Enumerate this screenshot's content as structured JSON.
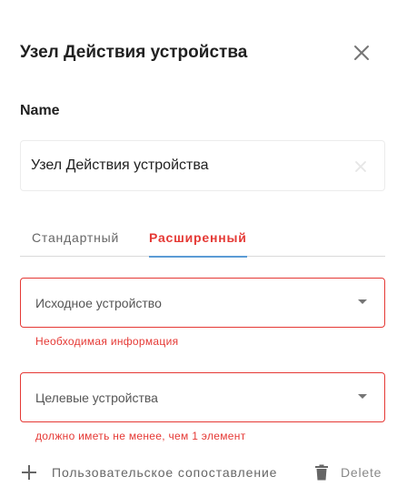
{
  "header": {
    "title": "Узел Действия устройства"
  },
  "name_section": {
    "label": "Name",
    "value": "Узел Действия устройства"
  },
  "tabs": [
    {
      "label": "Стандартный",
      "active": false
    },
    {
      "label": "Расширенный",
      "active": true
    }
  ],
  "fields": {
    "source_device": {
      "label": "Исходное устройство",
      "error": "Необходимая информация"
    },
    "target_devices": {
      "label": "Целевые устройства",
      "error": "должно иметь не менее, чем 1 элемент"
    }
  },
  "actions": {
    "custom_mapping_label": "Пользовательское сопоставление",
    "delete_label": "Delete"
  },
  "colors": {
    "accent_error": "#e53935",
    "tab_underline": "#5b9bd5",
    "text_primary": "#212121",
    "text_secondary": "#666666"
  },
  "icons": {
    "close": "close-icon",
    "clear": "clear-icon",
    "dropdown": "chevron-down-icon",
    "add": "plus-icon",
    "delete": "trash-icon"
  }
}
